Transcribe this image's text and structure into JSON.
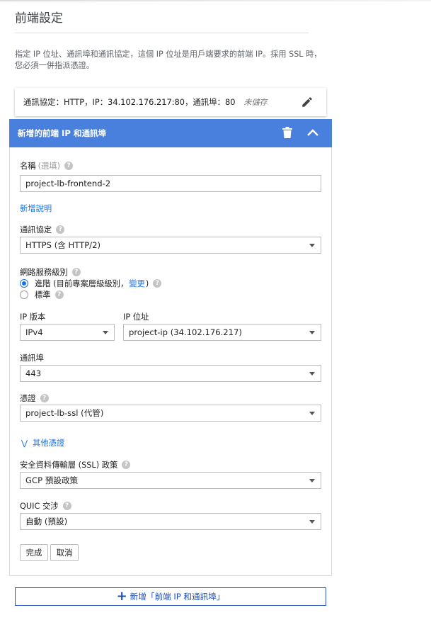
{
  "page": {
    "title": "前端設定",
    "description": "指定 IP 位址、通訊埠和通訊協定，這個 IP 位址是用戶端要求的前端 IP。採用 SSL 時，您必須一併指派憑證。"
  },
  "summary": {
    "text": "通訊協定：HTTP，IP：34.102.176.217:80，通訊埠：80",
    "status": "未儲存"
  },
  "panel": {
    "title": "新增的前端 IP 和通訊埠",
    "name": {
      "label": "名稱",
      "optional": "(選填)",
      "value": "project-lb-frontend-2"
    },
    "add_description": "新增說明",
    "protocol": {
      "label": "通訊協定",
      "value": "HTTPS (含 HTTP/2)"
    },
    "network_tier": {
      "label": "網路服務級別",
      "options": [
        {
          "label_prefix": "進階 (目前專案層級級別，",
          "link": "變更",
          "label_suffix": ")",
          "checked": true
        },
        {
          "label": "標準",
          "checked": false
        }
      ]
    },
    "ip_version": {
      "label": "IP 版本",
      "value": "IPv4"
    },
    "ip_address": {
      "label": "IP 位址",
      "value": "project-ip (34.102.176.217)"
    },
    "port": {
      "label": "通訊埠",
      "value": "443"
    },
    "certificate": {
      "label": "憑證",
      "value": "project-lb-ssl (代管)"
    },
    "more_certificates": "其他憑證",
    "ssl_policy": {
      "label": "安全資料傳輸層 (SSL) 政策",
      "value": "GCP 預設政策"
    },
    "quic": {
      "label": "QUIC 交涉",
      "value": "自動 (預設)"
    },
    "done_button": "完成",
    "cancel_button": "取消"
  },
  "add_frontend_button": "新增「前端 IP 和通訊埠」",
  "colors": {
    "header_blue": "#4a80dd",
    "link_blue": "#1a73e8",
    "border": "#bdbdbd"
  },
  "icons": {
    "edit": "pencil-icon",
    "delete": "trash-icon",
    "collapse": "chevron-up-icon",
    "help": "help-circle-icon",
    "expand": "chevron-double-down-icon",
    "add": "plus-icon"
  }
}
